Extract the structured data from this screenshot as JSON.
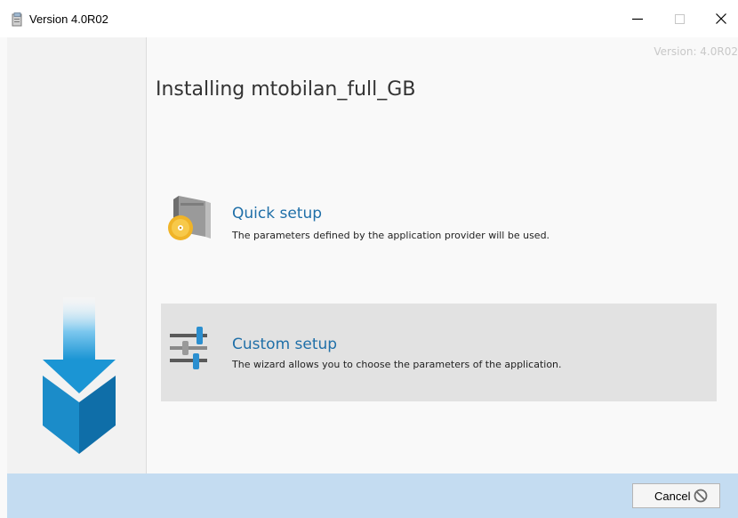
{
  "window": {
    "title": "Version 4.0R02",
    "controls": {
      "minimize": "—",
      "maximize": "☐",
      "close": "✕"
    }
  },
  "header": {
    "version_label": "Version: 4.0R02",
    "title": "Installing mtobilan_full_GB"
  },
  "options": [
    {
      "title": "Quick setup",
      "description": "The parameters defined by the application provider will be used.",
      "icon": "package-disc-icon",
      "selected": false
    },
    {
      "title": "Custom setup",
      "description": "The wizard allows you to choose the parameters of the application.",
      "icon": "sliders-icon",
      "selected": true
    }
  ],
  "footer": {
    "cancel_label": "Cancel",
    "cancel_icon": "prohibited-icon"
  },
  "colors": {
    "accent_title": "#1f6fa8",
    "footer_bg": "#c4dcf1",
    "selected_option_bg": "#e2e2e2",
    "arrow_blue": "#1b95d4"
  }
}
